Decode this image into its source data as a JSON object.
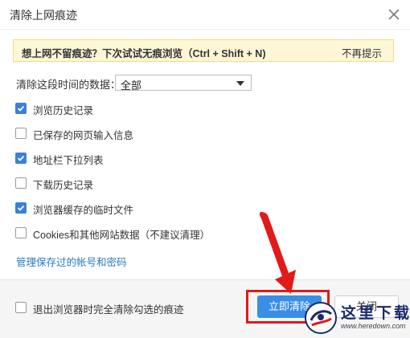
{
  "window": {
    "title": "清除上网痕迹"
  },
  "tip": {
    "text": "想上网不留痕迹？下次试试无痕浏览（Ctrl + Shift + N)",
    "dismiss_label": "不再提示"
  },
  "range": {
    "label": "清除这段时间的数据：",
    "selected": "全部"
  },
  "options": [
    {
      "label": "浏览历史记录",
      "checked": true
    },
    {
      "label": "已保存的网页输入信息",
      "checked": false
    },
    {
      "label": "地址栏下拉列表",
      "checked": true
    },
    {
      "label": "下载历史记录",
      "checked": false
    },
    {
      "label": "浏览器缓存的临时文件",
      "checked": true
    },
    {
      "label": "Cookies和其他网站数据（不建议清理）",
      "checked": false
    }
  ],
  "manage_link": "管理保存过的帐号和密码",
  "footer": {
    "exit_clear_label": "退出浏览器时完全清除勾选的痕迹",
    "exit_clear_checked": false,
    "clear_button": "立即清除",
    "cancel_button": "关闭"
  },
  "watermark": {
    "title": "这里下载",
    "url": "www.heredown.com"
  },
  "colors": {
    "accent": "#3a8ee6",
    "annotation": "#e11a1a",
    "tip_bg": "#fff6d6",
    "link": "#2a78c8"
  }
}
